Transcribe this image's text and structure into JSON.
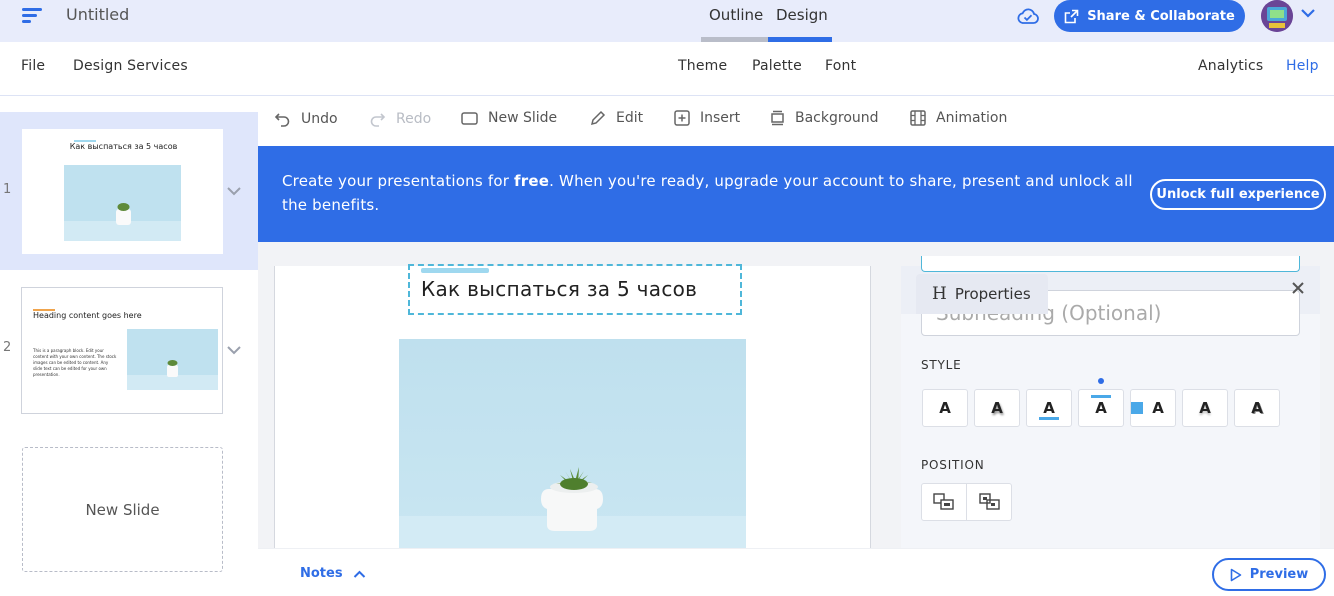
{
  "header": {
    "title": "Untitled",
    "tabs": [
      {
        "label": "Outline",
        "active": false
      },
      {
        "label": "Design",
        "active": true
      }
    ],
    "share_label": "Share & Collaborate",
    "accent_color": "#2f6de6"
  },
  "menubar": {
    "left": [
      "File",
      "Design Services"
    ],
    "center": [
      "Theme",
      "Palette",
      "Font"
    ],
    "right": [
      "Analytics",
      "Help"
    ]
  },
  "toolbar": {
    "undo": "Undo",
    "redo": "Redo",
    "new_slide": "New Slide",
    "edit": "Edit",
    "insert": "Insert",
    "background": "Background",
    "animation": "Animation"
  },
  "banner": {
    "text_before": "Create your presentations for ",
    "text_bold": "free",
    "text_after": ". When you're ready, upgrade your account to share, present and unlock all the benefits.",
    "button": "Unlock full experience"
  },
  "slides": [
    {
      "number": "1",
      "title": "Как выспаться за 5 часов"
    },
    {
      "number": "2",
      "title": "Heading content goes here",
      "body": "This is a paragraph block. Edit your content with your own content. The stock images can be edited to content. Any slide text can be edited for your own presentation."
    }
  ],
  "sidebar": {
    "new_slide": "New Slide"
  },
  "canvas": {
    "slide_title": "Как выспаться за 5 часов"
  },
  "properties": {
    "tab_icon": "H",
    "tab_label": "Properties",
    "subheading_placeholder": "Subheading (Optional)",
    "style_label": "STYLE",
    "position_label": "POSITION",
    "style_options": [
      "A",
      "A",
      "A",
      "A",
      "A",
      "A",
      "A"
    ]
  },
  "footer": {
    "notes": "Notes",
    "preview": "Preview"
  }
}
